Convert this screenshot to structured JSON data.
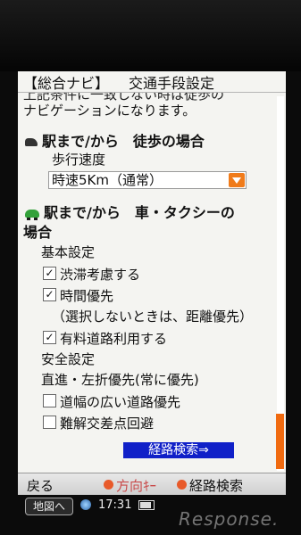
{
  "title": {
    "left": "【総合ナビ】",
    "right": "交通手段設定"
  },
  "intro": {
    "line1": "上記条件に一致しない時は徒歩の",
    "line2": "ナビゲーションになります。"
  },
  "walk_section": {
    "heading": "駅まで/から　徒歩の場合",
    "speed_label": "歩行速度",
    "speed_value": "時速5Km（通常）"
  },
  "car_section": {
    "heading_line1": "駅まで/から　車・タクシーの",
    "heading_line2": "場合",
    "basic_label": "基本設定",
    "options": [
      {
        "label": "渋滞考慮する",
        "checked": true
      },
      {
        "label": "時間優先",
        "checked": true
      },
      {
        "label": "有料道路利用する",
        "checked": true
      }
    ],
    "time_note": "（選択しないときは、距離優先）",
    "safety_label": "安全設定",
    "straight_turn": "直進・左折優先(常に優先)",
    "safety_options": [
      {
        "label": "道幅の広い道路優先",
        "checked": false
      },
      {
        "label": "難解交差点回避",
        "checked": false
      }
    ]
  },
  "search_button": "経路検索⇒",
  "softkeys": {
    "back": "戻る",
    "direction": "方向ｷｰ",
    "search": "経路検索"
  },
  "status": {
    "map_button": "地図へ",
    "time": "17:31"
  },
  "watermark": "Response."
}
